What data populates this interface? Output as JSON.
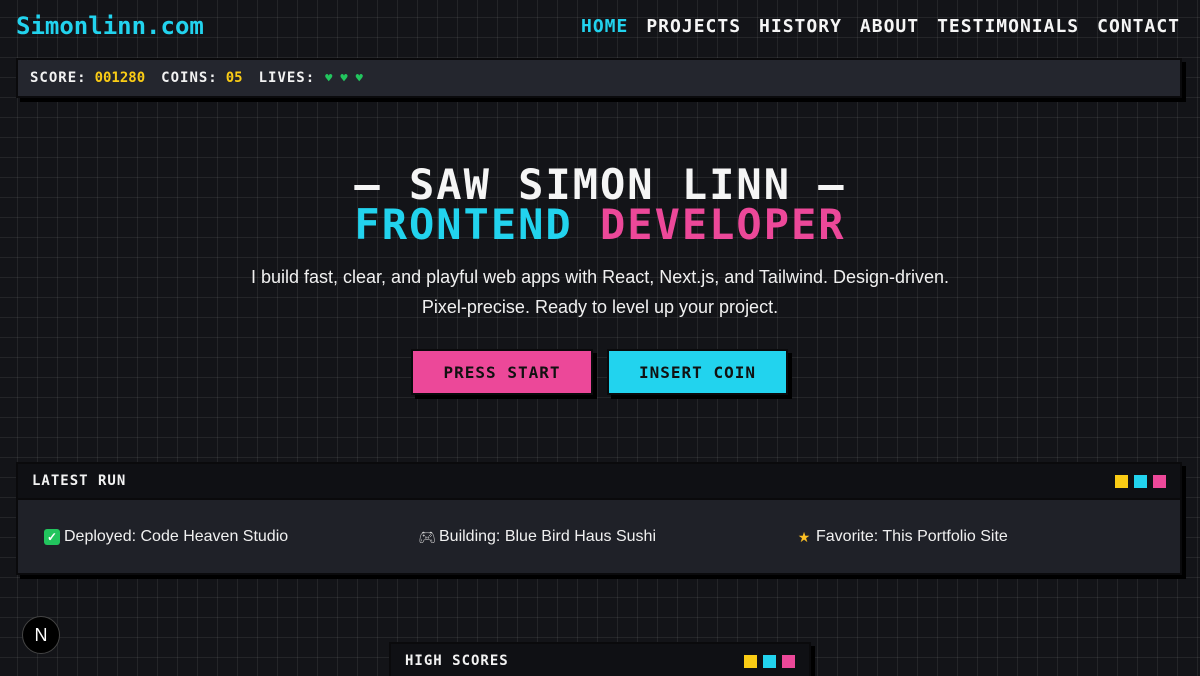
{
  "header": {
    "logo": "Simonlinn.com",
    "nav": [
      {
        "label": "HOME",
        "active": true
      },
      {
        "label": "PROJECTS"
      },
      {
        "label": "HISTORY"
      },
      {
        "label": "ABOUT"
      },
      {
        "label": "TESTIMONIALS"
      },
      {
        "label": "CONTACT"
      }
    ]
  },
  "hud": {
    "score_label": "SCORE:",
    "score_value": "001280",
    "coins_label": "COINS:",
    "coins_value": "05",
    "lives_label": "LIVES:",
    "lives_count": 3,
    "lives_icon": "heart-icon"
  },
  "hero": {
    "name_line": "— SAW SIMON LINN —",
    "role_a": "FRONTEND",
    "role_b": "DEVELOPER",
    "intro_line1": "I build fast, clear, and playful web apps with React, Next.js, and Tailwind. Design-driven.",
    "intro_line2": "Pixel-precise. Ready to level up your project.",
    "primary_button": "PRESS START",
    "secondary_button": "INSERT COIN"
  },
  "latest_run": {
    "title": "LATEST RUN",
    "items": [
      {
        "icon": "check-icon",
        "text": "Deployed: Code Heaven Studio"
      },
      {
        "icon": "gamepad-icon",
        "text": "Building: Blue Bird Haus Sushi"
      },
      {
        "icon": "star-icon",
        "text": "Favorite: This Portfolio Site"
      }
    ]
  },
  "high_scores": {
    "title": "HIGH SCORES"
  },
  "badge": {
    "letter": "N"
  },
  "colors": {
    "accent_cyan": "#22d3ee",
    "accent_pink": "#ec4899",
    "accent_yellow": "#facc15",
    "lives_green": "#22c55e",
    "background": "#131418"
  }
}
